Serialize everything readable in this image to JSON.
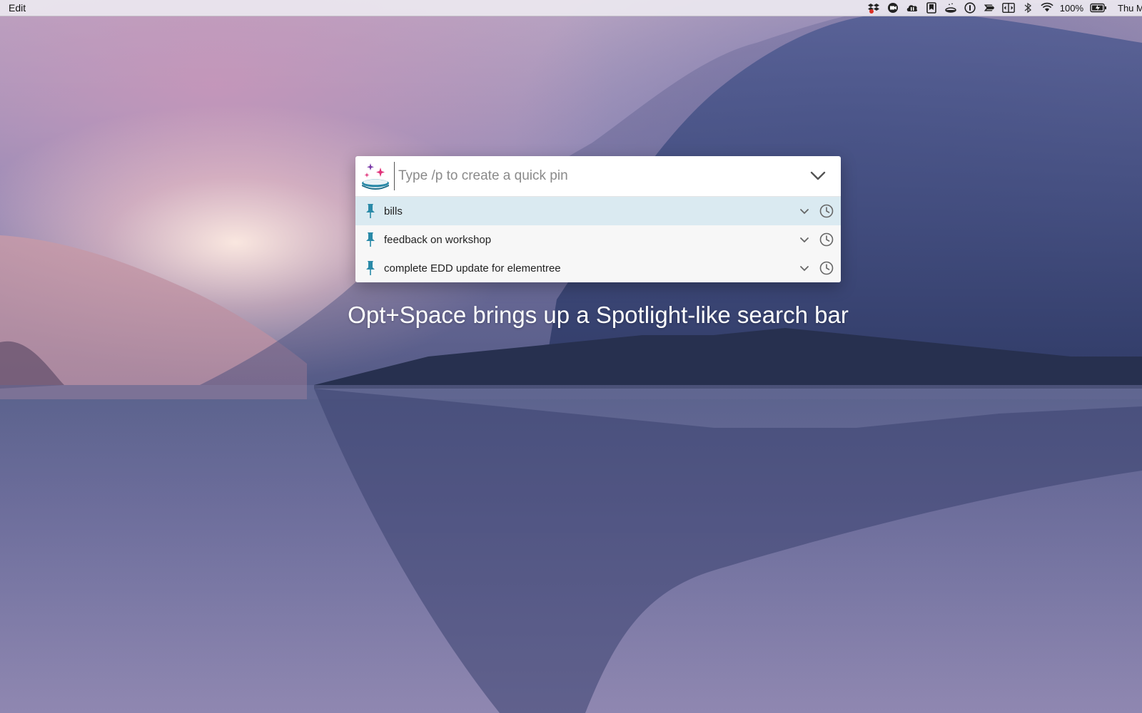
{
  "menubar": {
    "edit_label": "Edit",
    "battery_text": "100%",
    "clock_text": "Thu M",
    "status_icons": [
      "dropbox-icon",
      "record-icon",
      "cloud-icon",
      "bookmark-icon",
      "app-icon",
      "1password-icon",
      "bolt-icon",
      "split-view-icon",
      "bluetooth-icon",
      "wifi-icon",
      "battery-icon"
    ]
  },
  "search": {
    "placeholder": "Type /p to create a quick pin",
    "value": ""
  },
  "results": [
    {
      "label": "bills",
      "selected": true
    },
    {
      "label": "feedback on workshop",
      "selected": false
    },
    {
      "label": "complete EDD update for elementree",
      "selected": false
    }
  ],
  "caption": "Opt+Space brings up a Spotlight-like search bar",
  "colors": {
    "selected_row": "#daeaf1",
    "pin_color": "#2a8aa8",
    "icon_gray": "#6b6b6b"
  }
}
